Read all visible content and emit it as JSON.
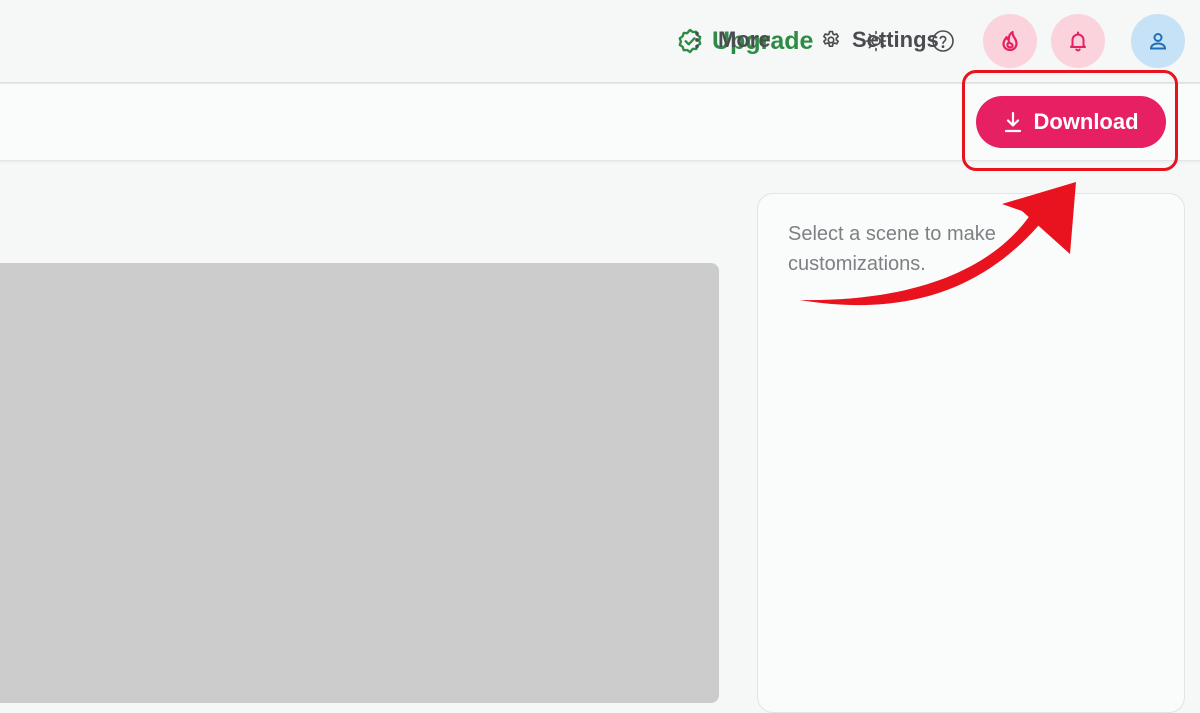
{
  "header": {
    "upgrade_label": "Upgrade",
    "upgrade_icon": "badge-check-icon",
    "buttons": [
      {
        "name": "theme-toggle",
        "icon": "sun-icon"
      },
      {
        "name": "help",
        "icon": "question-circle-icon"
      },
      {
        "name": "streak",
        "icon": "flame-icon"
      },
      {
        "name": "notifications",
        "icon": "bell-icon"
      },
      {
        "name": "account",
        "icon": "user-icon"
      }
    ]
  },
  "toolbar": {
    "more_label": "More",
    "settings_label": "Settings",
    "download_label": "Download"
  },
  "panel": {
    "hint": "Select a scene to make customizations."
  },
  "colors": {
    "accent": "#e62062",
    "upgrade": "#2e8b45",
    "annotation": "#e8131e",
    "canvas": "#cccccc"
  }
}
